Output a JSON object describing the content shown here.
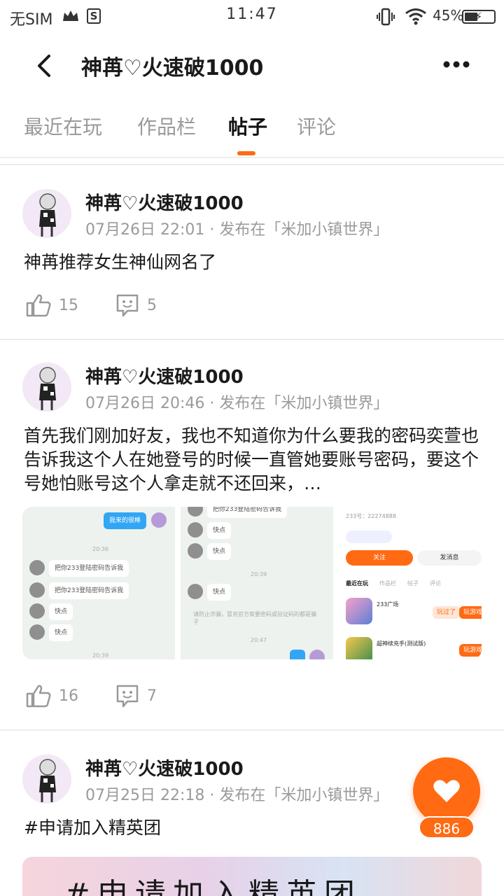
{
  "status_bar": {
    "carrier": "无SIM",
    "time": "11:47",
    "battery": "45%"
  },
  "header": {
    "title": "神苒♡火速破1000"
  },
  "tabs": [
    {
      "label": "最近在玩"
    },
    {
      "label": "作品栏"
    },
    {
      "label": "帖子"
    },
    {
      "label": "评论"
    }
  ],
  "posts": [
    {
      "author": "神苒♡火速破1000",
      "meta": "07月26日 22:01 · 发布在「米加小镇世界」",
      "text": "神苒推荐女生神仙网名了",
      "likes": "15",
      "comments": "5"
    },
    {
      "author": "神苒♡火速破1000",
      "meta": "07月26日 20:46 · 发布在「米加小镇世界」",
      "text": "首先我们刚加好友，我也不知道你为什么要我的密码奕萱也告诉我这个人在她登号的时候一直管她要账号密码，要这个号她怕账号这个人拿走就不还回来，…",
      "likes": "16",
      "comments": "7",
      "shot1": {
        "me": "我来的很棒",
        "msg1": "把你233登陆密码告诉我",
        "msg2": "把你233登陆密码告诉我",
        "msg3": "快点",
        "msg4": "快点",
        "time1": "20:36",
        "time2": "20:39"
      },
      "shot2": {
        "msg1": "把你233登陆密码告诉我",
        "msg2": "快点",
        "msg3": "快点",
        "msg4": "快点",
        "time1": "20:39",
        "time2": "20:47",
        "warning": "请防止诈骗，冒充官方索要密码或验证码的都是骗子"
      },
      "shot3": {
        "id": "233号：22274888",
        "follow": "关注",
        "message": "发消息",
        "tab1": "最近在玩",
        "tab2": "作品栏",
        "tab3": "帖子",
        "tab4": "评论",
        "game1": "233广场",
        "game1_tag": "玩过了",
        "game1_btn": "玩游戏",
        "game2": "超神续充手(测试版)",
        "game2_btn": "玩游戏"
      }
    },
    {
      "author": "神苒♡火速破1000",
      "meta": "07月25日 22:18 · 发布在「米加小镇世界」",
      "text": "#申请加入精英团",
      "banner": "#申请加入精英团"
    }
  ],
  "fab": {
    "likes": "886"
  },
  "colors": {
    "accent": "#ff6a13",
    "muted": "#9a9a9a"
  }
}
